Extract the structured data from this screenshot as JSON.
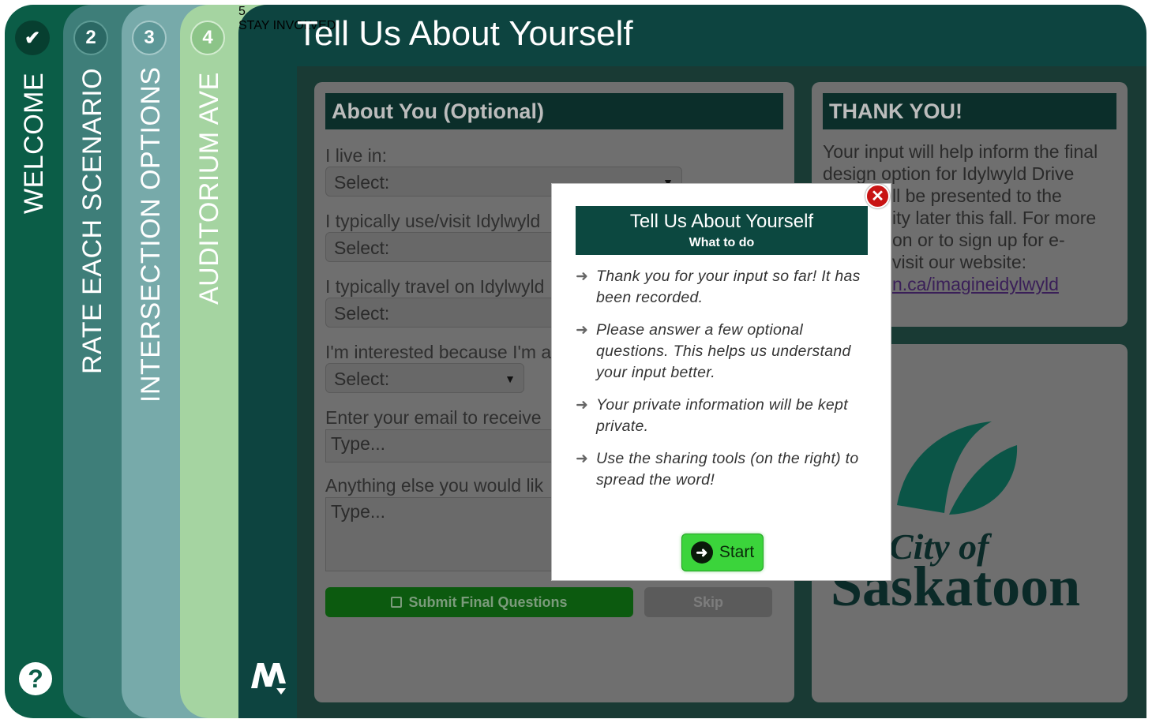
{
  "tabs": [
    {
      "step": "✔",
      "label": "WELCOME"
    },
    {
      "step": "2",
      "label": "RATE EACH SCENARIO"
    },
    {
      "step": "3",
      "label": "INTERSECTION OPTIONS"
    },
    {
      "step": "4",
      "label": "AUDITORIUM AVE"
    },
    {
      "step": "5",
      "label": "STAY INVOLVED"
    }
  ],
  "header": {
    "title": "Tell Us About Yourself"
  },
  "help_icon": "question-circle-icon",
  "brand_icon": "mq-logo-icon",
  "about_form": {
    "heading": "About You (Optional)",
    "fields": [
      {
        "label": "I live in:",
        "value": "Select:"
      },
      {
        "label": "I typically use/visit Idylwyld",
        "value": "Select:"
      },
      {
        "label": "I typically travel on Idylwyld",
        "value": "Select:"
      },
      {
        "label": "I'm interested because I'm a",
        "value": "Select:"
      }
    ],
    "email": {
      "label": "Enter your email to receive",
      "placeholder": "Type..."
    },
    "other": {
      "label": "Anything else you would lik",
      "placeholder": "Type..."
    },
    "submit_label": "Submit Final Questions",
    "skip_label": "Skip"
  },
  "thank_you": {
    "heading": "THANK YOU!",
    "lines": [
      "Your input will help inform the final",
      "design option for Idylwyld Drive",
      "ll be presented to the",
      "ity later this fall. For more",
      "on or to sign up for e-",
      "visit our website:"
    ],
    "link_text": "n.ca/imagineidylwyld"
  },
  "logo": {
    "line1": "City of",
    "line2": "Saskatoon"
  },
  "modal": {
    "title": "Tell Us About Yourself",
    "subtitle": "What to do",
    "tips": [
      "Thank you for your input so far! It has been recorded.",
      "Please answer a few optional questions. This helps us understand your input better.",
      "Your private information will be kept private.",
      "Use the sharing tools (on the right) to spread the word!"
    ],
    "start_label": "Start"
  },
  "colors": {
    "brand_dark": "#0d4440",
    "tab_welcome": "#0b5d47",
    "tab_rate": "#3e7e79",
    "tab_intersection": "#77aaaa",
    "tab_auditorium": "#a5d4a1",
    "start_green": "#3bd43b",
    "close_red": "#c81414"
  }
}
